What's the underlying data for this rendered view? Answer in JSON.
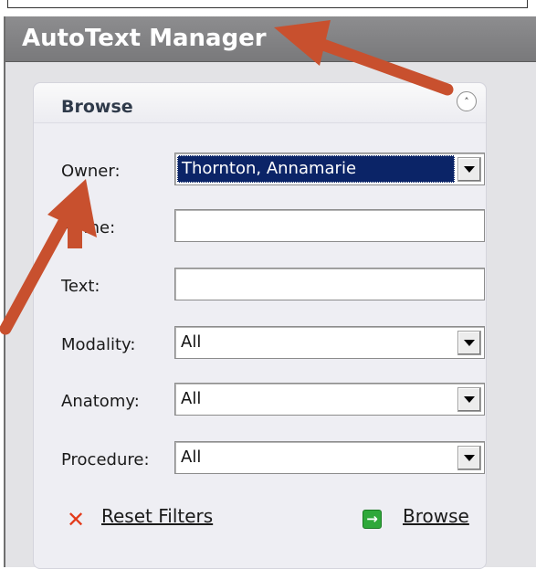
{
  "window": {
    "title": "AutoText Manager"
  },
  "panel": {
    "title": "Browse",
    "collapse_icon": "double-chevron-up-icon"
  },
  "fields": {
    "owner": {
      "label": "Owner:",
      "value": "Thornton, Annamarie"
    },
    "name": {
      "label": "Name:",
      "value": ""
    },
    "text": {
      "label": "Text:",
      "value": ""
    },
    "modality": {
      "label": "Modality:",
      "value": "All"
    },
    "anatomy": {
      "label": "Anatomy:",
      "value": "All"
    },
    "procedure": {
      "label": "Procedure:",
      "value": "All"
    }
  },
  "actions": {
    "reset_label": "Reset Filters",
    "reset_icon": "close-x-icon",
    "browse_label": "Browse",
    "browse_icon": "arrow-right-icon"
  },
  "colors": {
    "annotation_arrow": "#c8502e",
    "selected_bg": "#0b2467",
    "title_bar": "#828284"
  }
}
